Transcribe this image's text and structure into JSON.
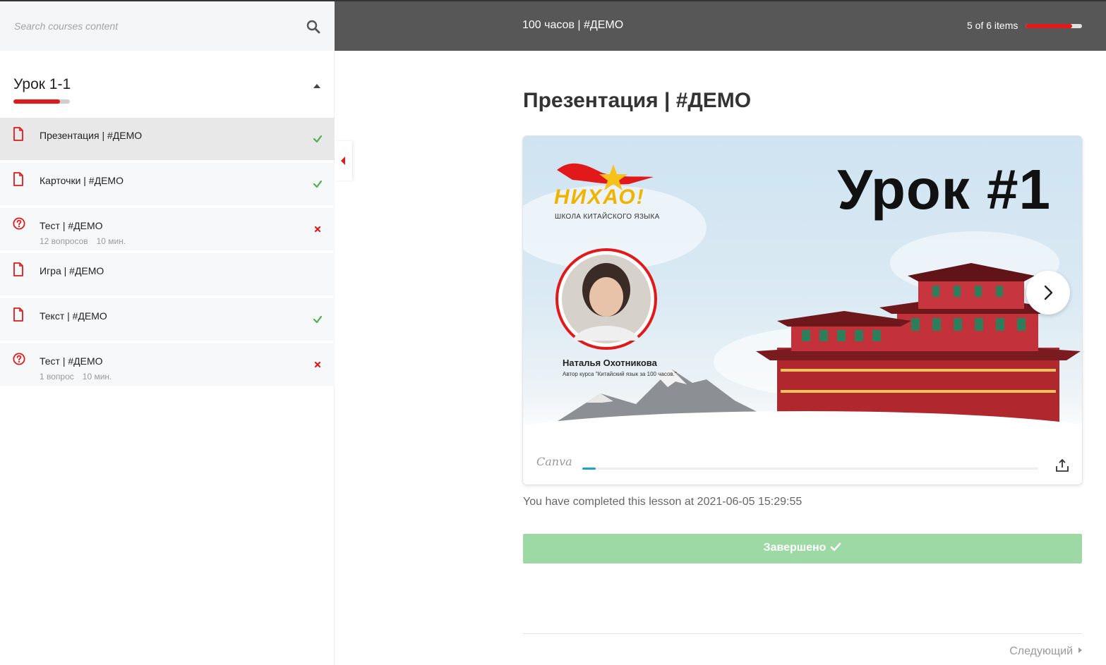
{
  "search": {
    "placeholder": "Search courses content"
  },
  "section": {
    "title": "Урок 1-1",
    "progress": 0.82
  },
  "items": [
    {
      "type": "doc",
      "label": "Презентация | #ДЕМО",
      "status": "done",
      "active": true,
      "meta": []
    },
    {
      "type": "doc",
      "label": "Карточки | #ДЕМО",
      "status": "done",
      "active": false,
      "meta": []
    },
    {
      "type": "quiz",
      "label": "Тест | #ДЕМО",
      "status": "failed",
      "active": false,
      "meta": [
        "12 вопросов",
        "10 мин."
      ]
    },
    {
      "type": "doc",
      "label": "Игра | #ДЕМО",
      "status": "none",
      "active": false,
      "meta": []
    },
    {
      "type": "doc",
      "label": "Текст | #ДЕМО",
      "status": "done",
      "active": false,
      "meta": []
    },
    {
      "type": "quiz",
      "label": "Тест | #ДЕМО",
      "status": "failed",
      "active": false,
      "meta": [
        "1 вопрос",
        "10 мин."
      ]
    }
  ],
  "header": {
    "course_title": "100 часов | #ДЕМО",
    "items_count": "5 of 6 items",
    "progress": 0.83
  },
  "lesson": {
    "title": "Презентация | #ДЕМО",
    "slide": {
      "heading": "Урок #1",
      "logo_text": "НИХАО!",
      "school": "ШКОЛА КИТАЙСКОГО ЯЗЫКА",
      "author_name": "Наталья Охотникова",
      "author_sub": "Автор курса \"Китайский язык за 100 часов.\""
    },
    "embed_brand": "Canva",
    "embed_progress": 0.03,
    "completed_text": "You have completed this lesson at 2021-06-05 15:29:55",
    "complete_button": "Завершено",
    "next_label": "Следующий"
  },
  "colors": {
    "accent": "#e2191b",
    "success": "#4caf50",
    "header_bg": "#575757",
    "complete_bg": "#9dd9a5"
  }
}
